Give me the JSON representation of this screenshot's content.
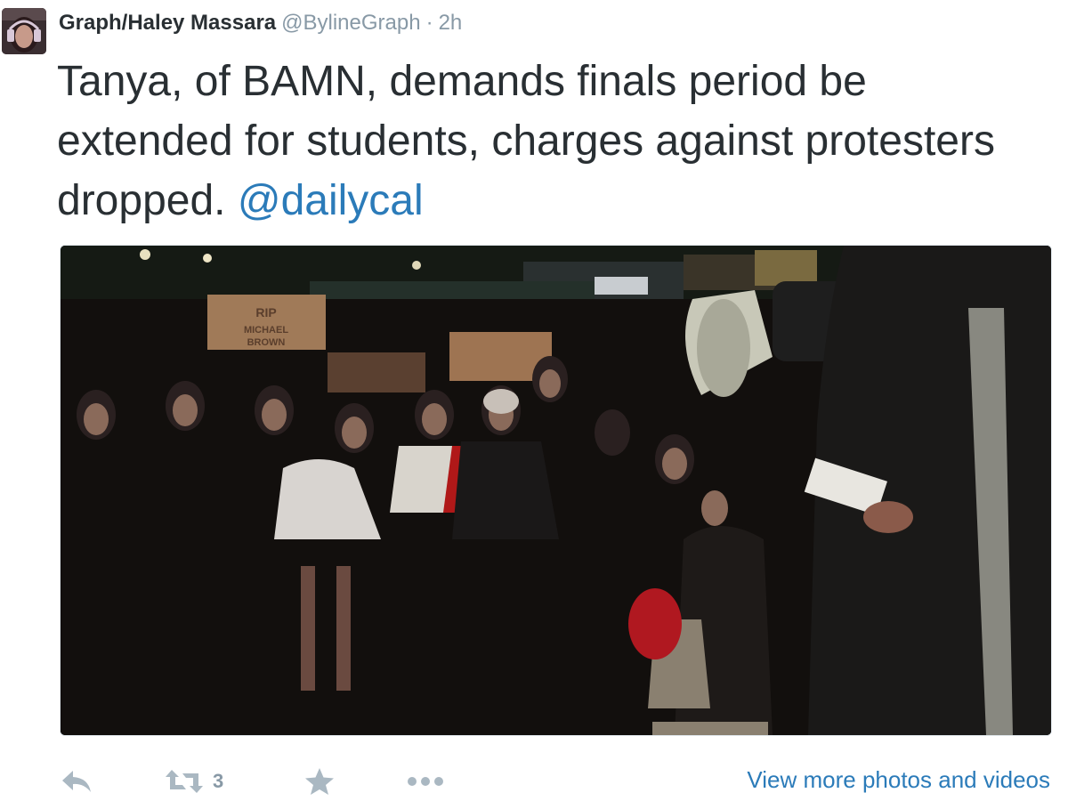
{
  "tweet": {
    "author_name": "Graph/Haley Massara",
    "handle": "@BylineGraph",
    "separator": "·",
    "time": "2h",
    "text_main": "Tanya, of BAMN, demands finals period be extended for students, charges against protesters dropped.",
    "mention": "@dailycal"
  },
  "media": {
    "sign_1": "RIP MICHAEL BROWN",
    "icon": "protest-photo"
  },
  "actions": {
    "reply_icon": "reply-icon",
    "retweet_icon": "retweet-icon",
    "retweet_count": "3",
    "favorite_icon": "star-icon",
    "more_icon": "more-dots-icon",
    "view_more": "View more photos and videos"
  },
  "colors": {
    "link": "#2b7bb9",
    "muted": "#8899a6",
    "text": "#292f33"
  }
}
